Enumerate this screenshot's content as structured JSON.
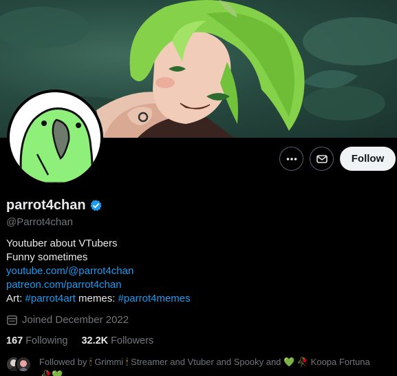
{
  "profile": {
    "display_name": "parrot4chan",
    "handle": "@Parrot4chan",
    "verified_icon": "verified-badge-icon",
    "accent_color": "#1d9bf0"
  },
  "actions": {
    "more_icon": "more-icon",
    "message_icon": "message-icon",
    "follow_label": "Follow"
  },
  "bio": {
    "line1": "Youtuber about VTubers",
    "line2": "Funny sometimes",
    "link_youtube": "youtube.com/@parrot4chan",
    "link_patreon": "patreon.com/parrot4chan",
    "art_label": "Art: ",
    "art_tag": "#parrot4art",
    "memes_label": " memes: ",
    "memes_tag": "#parrot4memes"
  },
  "joined": {
    "icon": "calendar-icon",
    "text": "Joined December 2022"
  },
  "stats": {
    "following_count": "167",
    "following_label": "Following",
    "followers_count": "32.2K",
    "followers_label": "Followers"
  },
  "followed_by": {
    "prefix": "Followed by ",
    "user1": "Grimmi",
    "user2": "Streamer and Vtuber and Spooky and",
    "user3": "Koopa Fortuna"
  }
}
